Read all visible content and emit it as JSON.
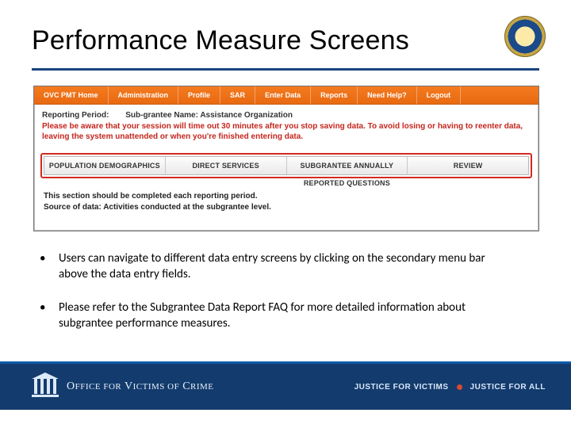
{
  "title": "Performance Measure Screens",
  "nav": [
    "OVC PMT Home",
    "Administration",
    "Profile",
    "SAR",
    "Enter Data",
    "Reports",
    "Need Help?",
    "Logout"
  ],
  "report_label": "Reporting Period:",
  "subgrantee_label": "Sub-grantee Name: Assistance Organization",
  "warning": "Please be aware that your session will time out 30 minutes after you stop saving data. To avoid losing or having to reenter data, leaving the system unattended or when you're finished entering data.",
  "subtabs": [
    "POPULATION DEMOGRAPHICS",
    "DIRECT SERVICES",
    "SUBGRANTEE ANNUALLY REPORTED QUESTIONS",
    "REVIEW"
  ],
  "section_line1": "This section should be completed each reporting period.",
  "section_line2": "Source of data: Activities conducted at the subgrantee level.",
  "bullets": [
    "Users can navigate to different data entry screens by clicking on the secondary menu bar above the data entry fields.",
    "Please refer to the Subgrantee Data Report FAQ for more detailed information about subgrantee performance measures."
  ],
  "footer": {
    "wordmark_pre": "O",
    "wordmark_sm1": "FFICE FOR",
    "wordmark_mid": " V",
    "wordmark_sm2": "ICTIMS OF",
    "wordmark_end": " C",
    "wordmark_sm3": "RIME",
    "tag_left": "JUSTICE FOR VICTIMS",
    "tag_right": "JUSTICE FOR ALL"
  }
}
